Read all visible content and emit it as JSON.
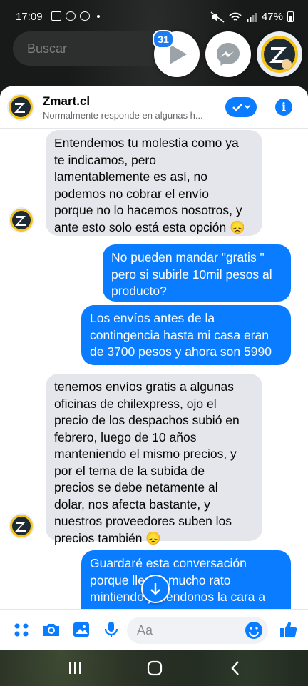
{
  "status": {
    "time": "17:09",
    "battery": "47%"
  },
  "search": {
    "placeholder": "Buscar"
  },
  "chat_heads": {
    "badge_count": "31"
  },
  "header": {
    "name": "Zmart.cl",
    "subtitle": "Normalmente responde en algunas h..."
  },
  "messages": [
    {
      "from": "page",
      "text": "Entendemos tu molestia como ya\nte indicamos, pero\nlamentablemente es así, no\npodemos no cobrar el envío\nporque no lo hacemos nosotros, y\nante esto solo está esta opción 😞"
    },
    {
      "from": "me",
      "text": "No pueden mandar  \"gratis \"\npero si subirle 10mil pesos al\nproducto?"
    },
    {
      "from": "me",
      "text": "Los envíos antes de la\ncontingencia hasta mi casa eran\nde 3700 pesos y ahora son 5990"
    },
    {
      "from": "page",
      "text": "tenemos envíos gratis a algunas\noficinas de chilexpress, ojo el\nprecio de los despachos subió en\nfebrero, luego de 10 años\nmanteniendo el mismo precios, y\npor el tema de la subida de\nprecios se debe netamente al\ndolar, nos afecta bastante, y\nnuestros proveedores suben los\nprecios también 😞"
    },
    {
      "from": "me",
      "text": "Guardaré esta conversación\nporque llevan mucho rato\nmintiendo y viéndonos la cara a\ntodos"
    }
  ],
  "composer": {
    "placeholder": "Aa"
  },
  "colors": {
    "accent": "#0a7cff",
    "incoming_bubble": "#e4e6eb",
    "logo_yellow": "#f6c416"
  }
}
